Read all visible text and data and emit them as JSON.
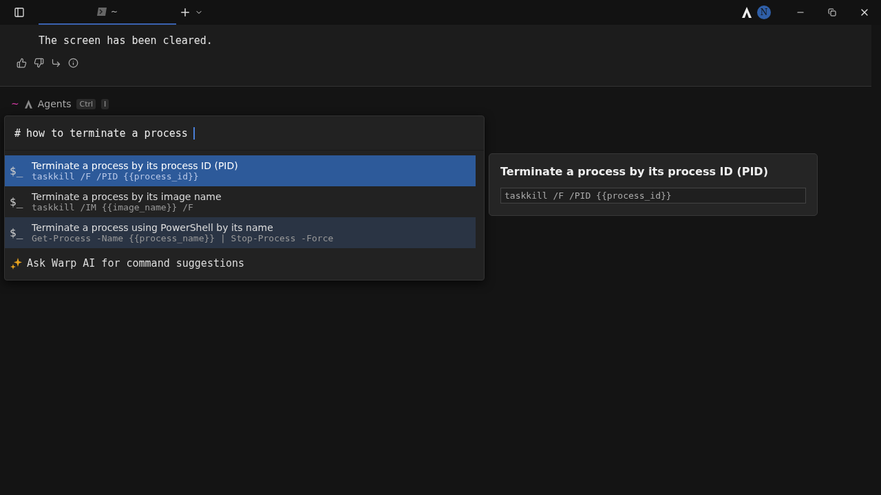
{
  "tab": {
    "title": "~",
    "selected": true
  },
  "output": {
    "text": "The screen has been cleared."
  },
  "prompt": {
    "directory": "~",
    "agents_label": "Agents",
    "keys": [
      "Ctrl",
      "I"
    ]
  },
  "avatar": {
    "initial": "N"
  },
  "search": {
    "prefix": "#",
    "value": "how to terminate a process"
  },
  "suggestions": [
    {
      "icon": "$_",
      "title": "Terminate a process by its process ID (PID)",
      "command": "taskkill /F /PID {{process_id}}",
      "selected": true,
      "hovered": false
    },
    {
      "icon": "$_",
      "title": "Terminate a process by its image name",
      "command": "taskkill /IM {{image_name}} /F",
      "selected": false,
      "hovered": false
    },
    {
      "icon": "$_",
      "title": "Terminate a process using PowerShell by its name",
      "command": "Get-Process -Name {{process_name}} | Stop-Process -Force",
      "selected": false,
      "hovered": true
    }
  ],
  "ask_ai": {
    "label": "Ask Warp AI for command suggestions"
  },
  "preview": {
    "title": "Terminate a process by its process ID (PID)",
    "command": "taskkill /F /PID {{process_id}}"
  }
}
